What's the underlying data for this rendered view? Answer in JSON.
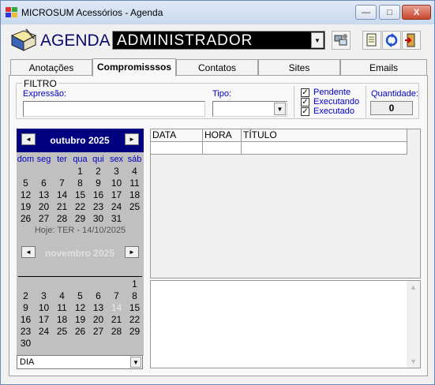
{
  "window": {
    "title": "MICROSUM Acessórios - Agenda",
    "min_label": "—",
    "max_label": "□",
    "close_label": "X"
  },
  "header": {
    "agenda_label": "AGENDA",
    "user": "ADMINISTRADOR",
    "combo_arrow": "▼"
  },
  "tabs": [
    {
      "label": "Anotações"
    },
    {
      "label": "Compromissso s",
      "display": "Compromissso s"
    },
    {
      "label": "Contatos"
    },
    {
      "label": "Sites"
    },
    {
      "label": "Emails"
    }
  ],
  "tab_labels": [
    "Anotações",
    "Compromisssos",
    "Contatos",
    "Sites",
    "Emails"
  ],
  "filtro": {
    "title": "FILTRO",
    "expressao_label": "Expressão:",
    "expressao_value": "",
    "tipo_label": "Tipo:",
    "tipo_value": "",
    "status": [
      {
        "label": "Pendente",
        "checked": true
      },
      {
        "label": "Executando",
        "checked": true
      },
      {
        "label": "Executado",
        "checked": true
      }
    ],
    "quantidade_label": "Quantidade:",
    "quantidade_value": "0"
  },
  "calendar": {
    "weekdays": [
      "dom",
      "seg",
      "ter",
      "qua",
      "qui",
      "sex",
      "sáb"
    ],
    "month1": {
      "title": "outubro 2025",
      "prev": "◄",
      "next": "►",
      "rows": [
        [
          "",
          "",
          "",
          "1",
          "2",
          "3",
          "4"
        ],
        [
          "5",
          "6",
          "7",
          "8",
          "9",
          "10",
          "11"
        ],
        [
          "12",
          "13",
          "14",
          "15",
          "16",
          "17",
          "18"
        ],
        [
          "19",
          "20",
          "21",
          "22",
          "23",
          "24",
          "25"
        ],
        [
          "26",
          "27",
          "28",
          "29",
          "30",
          "31",
          ""
        ]
      ]
    },
    "today_text": "Hoje: TER - 14/10/2025",
    "month2": {
      "title": "novembro 2025",
      "prev": "◄",
      "next": "►",
      "rows": [
        [
          "",
          "",
          "",
          "",
          "",
          "",
          "1"
        ],
        [
          "2",
          "3",
          "4",
          "5",
          "6",
          "7",
          "8"
        ],
        [
          "9",
          "10",
          "11",
          "12",
          "13",
          "14",
          "15"
        ],
        [
          "16",
          "17",
          "18",
          "19",
          "20",
          "21",
          "22"
        ],
        [
          "23",
          "24",
          "25",
          "26",
          "27",
          "28",
          "29"
        ],
        [
          "30",
          "",
          "",
          "",
          "",
          "",
          ""
        ]
      ]
    },
    "mode": "DIA"
  },
  "grid": {
    "columns": [
      "DATA",
      "HORA",
      "TÍTULO"
    ]
  },
  "colors": {
    "accent": "#000080",
    "label_blue": "#0000c0"
  }
}
